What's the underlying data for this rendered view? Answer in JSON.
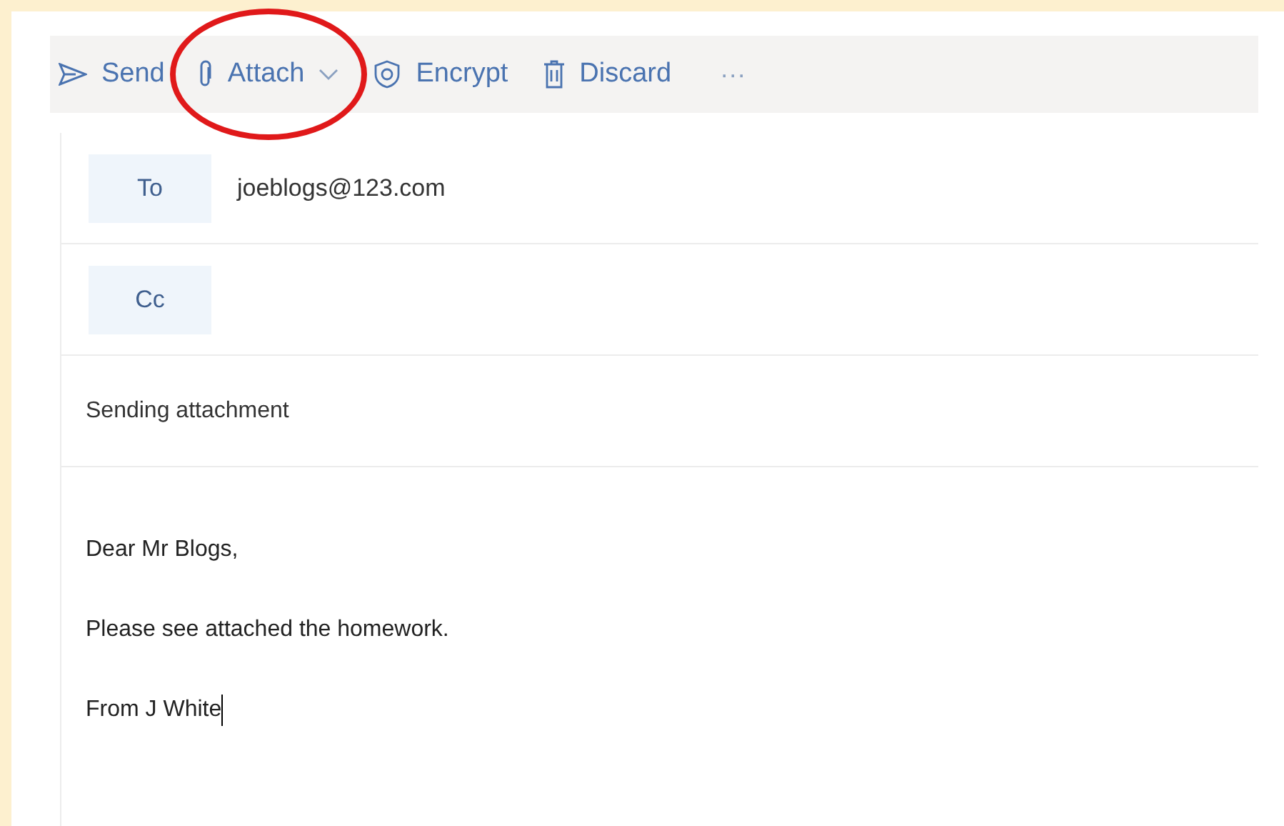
{
  "toolbar": [
    {
      "label": "Send",
      "has_menu": false,
      "highlighted": false
    },
    {
      "label": "Attach",
      "has_menu": true,
      "highlighted": true
    },
    {
      "label": "Encrypt",
      "has_menu": false,
      "highlighted": false
    },
    {
      "label": "Discard",
      "has_menu": false,
      "highlighted": false
    }
  ],
  "more": "···",
  "recipients": [
    {
      "label": "To",
      "value": "joeblogs@123.com"
    },
    {
      "label": "Cc"
    }
  ],
  "subject": "Sending attachment",
  "body": [
    {
      "text": "Dear Mr Blogs,",
      "cursor": false
    },
    {
      "text": "Please see attached the homework.",
      "cursor": false
    },
    {
      "text": "From J White",
      "cursor": true
    }
  ]
}
